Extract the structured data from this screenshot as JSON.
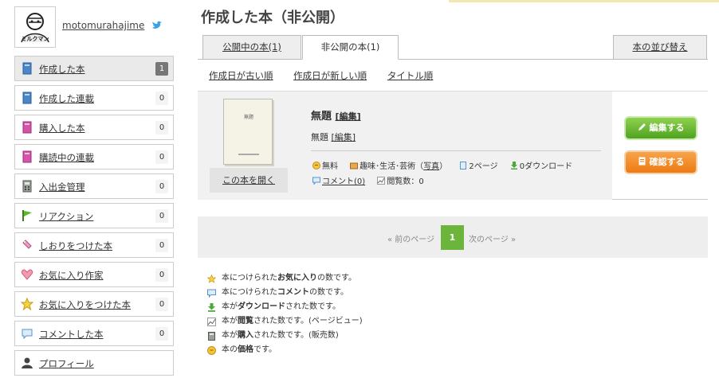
{
  "page_title": "作成した本（非公開）",
  "user": {
    "name": "motomurahajime"
  },
  "sidebar": {
    "items": [
      {
        "label": "作成した本",
        "count": "1",
        "icon": "book-blue-icon"
      },
      {
        "label": "作成した連載",
        "count": "0",
        "icon": "book-blue-icon"
      },
      {
        "label": "購入した本",
        "count": "0",
        "icon": "book-pink-icon"
      },
      {
        "label": "購読中の連載",
        "count": "0",
        "icon": "book-pink-icon"
      },
      {
        "label": "入出金管理",
        "count": "0",
        "icon": "calculator-icon"
      },
      {
        "label": "リアクション",
        "count": "0",
        "icon": "flag-icon"
      },
      {
        "label": "しおりをつけた本",
        "count": "0",
        "icon": "bookmark-icon"
      },
      {
        "label": "お気に入り作家",
        "count": "0",
        "icon": "heart-icon"
      },
      {
        "label": "お気に入りをつけた本",
        "count": "0",
        "icon": "star-icon"
      },
      {
        "label": "コメントした本",
        "count": "0",
        "icon": "comment-icon"
      },
      {
        "label": "プロフィール",
        "icon": "person-icon"
      }
    ]
  },
  "tabs": {
    "public": "公開中の本(1)",
    "private": "非公開の本(1)",
    "sort": "本の並び替え"
  },
  "sort_links": [
    "作成日が古い順",
    "作成日が新しい順",
    "タイトル順"
  ],
  "book": {
    "cover_text": "無題",
    "open_label": "この本を開く",
    "title": "無題",
    "edit_bracket": "[編集]",
    "subtitle": "無題",
    "sub_edit": "[編集]",
    "price": "無料",
    "category": "趣味･生活･芸術（",
    "category_link": "写真",
    "category_end": "）",
    "pages": "2ページ",
    "downloads": "0ダウンロード",
    "comments": "コメント(0)",
    "views": "閲覧数：0",
    "edit_button": "編集する",
    "confirm_button": "確認する"
  },
  "pager": {
    "prev": "« 前のページ",
    "current": "1",
    "next": "次のページ »"
  },
  "legend": [
    {
      "pre": "本につけられた",
      "bold": "お気に入り",
      "post": "の数です。",
      "icon": "star-icon"
    },
    {
      "pre": "本につけられた",
      "bold": "コメント",
      "post": "の数です。",
      "icon": "comment-icon"
    },
    {
      "pre": "本が",
      "bold": "ダウンロード",
      "post": "された数です。",
      "icon": "download-icon"
    },
    {
      "pre": "本が",
      "bold": "閲覧",
      "post": "された数です。(ページビュー)",
      "icon": "chart-icon"
    },
    {
      "pre": "本が",
      "bold": "購入",
      "post": "された数です。(販売数)",
      "icon": "calculator-icon"
    },
    {
      "pre": "本の",
      "bold": "価格",
      "post": "です。",
      "icon": "coin-icon"
    }
  ]
}
